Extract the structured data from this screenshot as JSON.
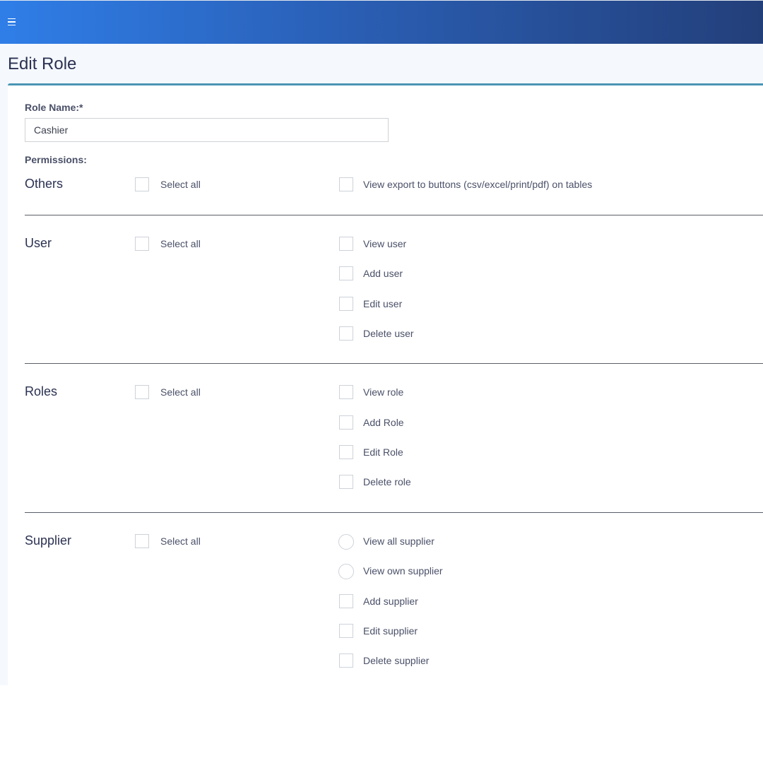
{
  "header": {
    "menu_icon": "hamburger-menu-icon"
  },
  "page": {
    "title": "Edit Role"
  },
  "form": {
    "role_name_label": "Role Name:*",
    "role_name_value": "Cashier",
    "permissions_label": "Permissions:"
  },
  "groups": [
    {
      "title": "Others",
      "select_all": "Select all",
      "options": [
        {
          "label": "View export to buttons (csv/excel/print/pdf) on tables",
          "control": "checkbox",
          "checked": false
        }
      ]
    },
    {
      "title": "User",
      "select_all": "Select all",
      "options": [
        {
          "label": "View user",
          "control": "checkbox",
          "checked": false
        },
        {
          "label": "Add user",
          "control": "checkbox",
          "checked": false
        },
        {
          "label": "Edit user",
          "control": "checkbox",
          "checked": false
        },
        {
          "label": "Delete user",
          "control": "checkbox",
          "checked": false
        }
      ]
    },
    {
      "title": "Roles",
      "select_all": "Select all",
      "options": [
        {
          "label": "View role",
          "control": "checkbox",
          "checked": false
        },
        {
          "label": "Add Role",
          "control": "checkbox",
          "checked": false
        },
        {
          "label": "Edit Role",
          "control": "checkbox",
          "checked": false
        },
        {
          "label": "Delete role",
          "control": "checkbox",
          "checked": false
        }
      ]
    },
    {
      "title": "Supplier",
      "select_all": "Select all",
      "options": [
        {
          "label": "View all supplier",
          "control": "radio",
          "checked": false
        },
        {
          "label": "View own supplier",
          "control": "radio",
          "checked": false
        },
        {
          "label": "Add supplier",
          "control": "checkbox",
          "checked": false
        },
        {
          "label": "Edit supplier",
          "control": "checkbox",
          "checked": false
        },
        {
          "label": "Delete supplier",
          "control": "checkbox",
          "checked": false
        }
      ]
    }
  ],
  "colors": {
    "header_gradient_start": "#2f7ee8",
    "header_gradient_end": "#233f7a",
    "card_accent": "#4a95b5",
    "title_text": "#2b3252"
  }
}
